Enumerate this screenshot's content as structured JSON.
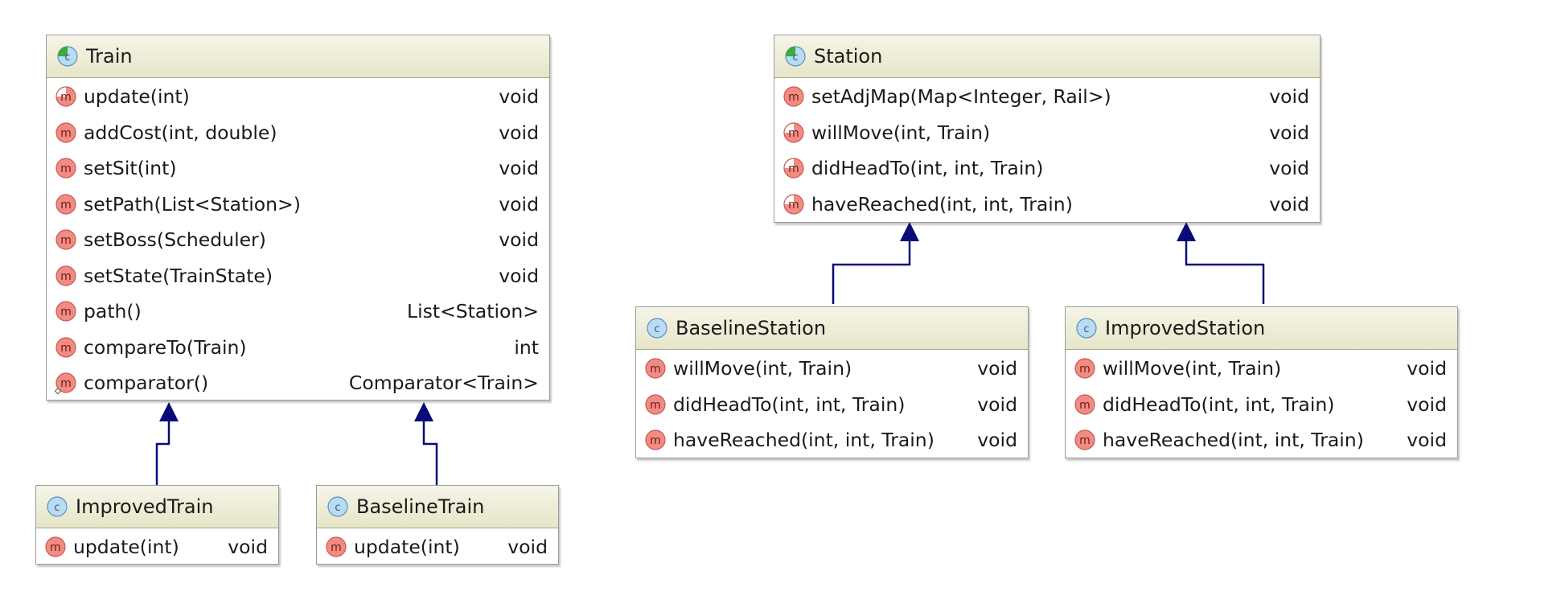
{
  "colors": {
    "header_bg": "#ebeacb",
    "method_icon": "#f28b83",
    "class_icon": "#b9dcf5",
    "abstract_marker": "#3daa3d",
    "arrow": "#0a0a7a"
  },
  "classes": {
    "train": {
      "name": "Train",
      "kind": "abstract-class",
      "methods": [
        {
          "sig": "update(int)",
          "ret": "void",
          "icon": "abstract-method-icon"
        },
        {
          "sig": "addCost(int, double)",
          "ret": "void",
          "icon": "method-icon"
        },
        {
          "sig": "setSit(int)",
          "ret": "void",
          "icon": "method-icon"
        },
        {
          "sig": "setPath(List<Station>)",
          "ret": "void",
          "icon": "method-icon"
        },
        {
          "sig": "setBoss(Scheduler)",
          "ret": "void",
          "icon": "method-icon"
        },
        {
          "sig": "setState(TrainState)",
          "ret": "void",
          "icon": "method-icon"
        },
        {
          "sig": "path()",
          "ret": "List<Station>",
          "icon": "method-icon"
        },
        {
          "sig": "compareTo(Train)",
          "ret": "int",
          "icon": "method-icon"
        },
        {
          "sig": "comparator()",
          "ret": "Comparator<Train>",
          "icon": "static-method-icon"
        }
      ]
    },
    "improved_train": {
      "name": "ImprovedTrain",
      "kind": "class",
      "methods": [
        {
          "sig": "update(int)",
          "ret": "void",
          "icon": "method-icon"
        }
      ]
    },
    "baseline_train": {
      "name": "BaselineTrain",
      "kind": "class",
      "methods": [
        {
          "sig": "update(int)",
          "ret": "void",
          "icon": "method-icon"
        }
      ]
    },
    "station": {
      "name": "Station",
      "kind": "abstract-class",
      "methods": [
        {
          "sig": "setAdjMap(Map<Integer, Rail>)",
          "ret": "void",
          "icon": "method-icon"
        },
        {
          "sig": "willMove(int, Train)",
          "ret": "void",
          "icon": "abstract-method-icon"
        },
        {
          "sig": "didHeadTo(int, int, Train)",
          "ret": "void",
          "icon": "abstract-method-icon"
        },
        {
          "sig": "haveReached(int, int, Train)",
          "ret": "void",
          "icon": "abstract-method-icon"
        }
      ]
    },
    "baseline_station": {
      "name": "BaselineStation",
      "kind": "class",
      "methods": [
        {
          "sig": "willMove(int, Train)",
          "ret": "void",
          "icon": "method-icon"
        },
        {
          "sig": "didHeadTo(int, int, Train)",
          "ret": "void",
          "icon": "method-icon"
        },
        {
          "sig": "haveReached(int, int, Train)",
          "ret": "void",
          "icon": "method-icon"
        }
      ]
    },
    "improved_station": {
      "name": "ImprovedStation",
      "kind": "class",
      "methods": [
        {
          "sig": "willMove(int, Train)",
          "ret": "void",
          "icon": "method-icon"
        },
        {
          "sig": "didHeadTo(int, int, Train)",
          "ret": "void",
          "icon": "method-icon"
        },
        {
          "sig": "haveReached(int, int, Train)",
          "ret": "void",
          "icon": "method-icon"
        }
      ]
    }
  },
  "relations": [
    {
      "from": "ImprovedTrain",
      "to": "Train",
      "type": "inheritance"
    },
    {
      "from": "BaselineTrain",
      "to": "Train",
      "type": "inheritance"
    },
    {
      "from": "BaselineStation",
      "to": "Station",
      "type": "inheritance"
    },
    {
      "from": "ImprovedStation",
      "to": "Station",
      "type": "inheritance"
    }
  ]
}
